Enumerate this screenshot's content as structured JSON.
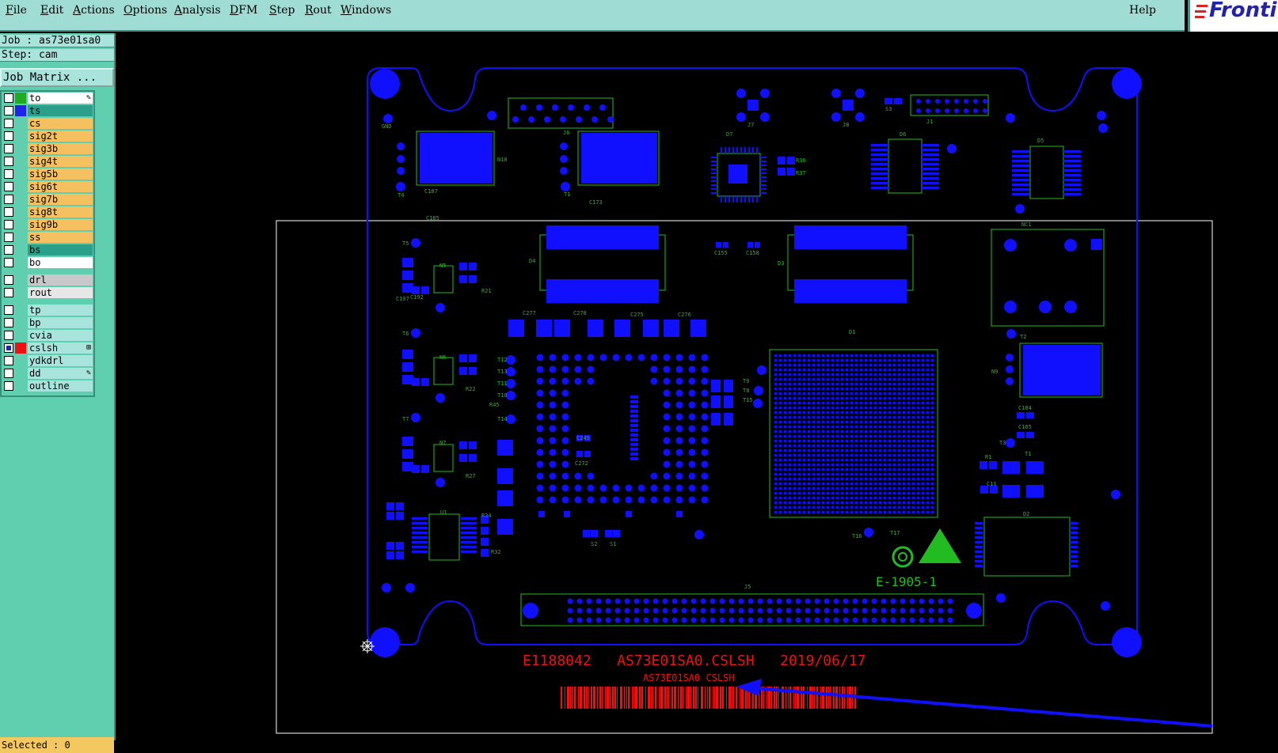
{
  "menu": [
    {
      "label": "File",
      "underline": "F",
      "rest": "ile"
    },
    {
      "label": "Edit",
      "underline": "E",
      "rest": "dit"
    },
    {
      "label": "Actions",
      "underline": "A",
      "rest": "ctions"
    },
    {
      "label": "Options",
      "underline": "O",
      "rest": "ptions"
    },
    {
      "label": "Analysis",
      "underline": "A",
      "rest": "nalysis"
    },
    {
      "label": "DFM",
      "underline": "D",
      "rest": "FM"
    },
    {
      "label": "Step",
      "underline": "S",
      "rest": "tep"
    },
    {
      "label": "Rout",
      "underline": "R",
      "rest": "out"
    },
    {
      "label": "Windows",
      "underline": "W",
      "rest": "indows"
    }
  ],
  "help": "Help",
  "logo": "Fronti",
  "job": "Job : as73e01sa0",
  "step": "Step: cam",
  "job_matrix": "Job Matrix ...",
  "status": "Selected : 0",
  "layers": [
    {
      "name": "to",
      "swatch": "#22aa22",
      "bg": "#ffffff",
      "mark": "✎",
      "checked": false
    },
    {
      "name": "ts",
      "swatch": "#2222ee",
      "bg": "#2aa08a",
      "mark": "",
      "checked": false
    },
    {
      "name": "cs",
      "swatch": "",
      "bg": "#f4c060",
      "mark": "",
      "checked": false
    },
    {
      "name": "sig2t",
      "swatch": "",
      "bg": "#f4c060",
      "mark": "",
      "checked": false
    },
    {
      "name": "sig3b",
      "swatch": "",
      "bg": "#f4c060",
      "mark": "",
      "checked": false
    },
    {
      "name": "sig4t",
      "swatch": "",
      "bg": "#f4c060",
      "mark": "",
      "checked": false
    },
    {
      "name": "sig5b",
      "swatch": "",
      "bg": "#f4c060",
      "mark": "",
      "checked": false
    },
    {
      "name": "sig6t",
      "swatch": "",
      "bg": "#f4c060",
      "mark": "",
      "checked": false
    },
    {
      "name": "sig7b",
      "swatch": "",
      "bg": "#f4c060",
      "mark": "",
      "checked": false
    },
    {
      "name": "sig8t",
      "swatch": "",
      "bg": "#f4c060",
      "mark": "",
      "checked": false
    },
    {
      "name": "sig9b",
      "swatch": "",
      "bg": "#f4c060",
      "mark": "",
      "checked": false
    },
    {
      "name": "ss",
      "swatch": "",
      "bg": "#f4c060",
      "mark": "",
      "checked": false
    },
    {
      "name": "bs",
      "swatch": "",
      "bg": "#2aa08a",
      "mark": "",
      "checked": false
    },
    {
      "name": "bo",
      "swatch": "",
      "bg": "#ffffff",
      "mark": "",
      "checked": false
    },
    {
      "sep": true
    },
    {
      "name": "drl",
      "swatch": "",
      "bg": "#c8c8c8",
      "mark": "",
      "checked": false
    },
    {
      "name": "rout",
      "swatch": "",
      "bg": "#e6e6e6",
      "mark": "",
      "checked": false
    },
    {
      "sep": true
    },
    {
      "name": "tp",
      "swatch": "",
      "bg": "#a8e4dc",
      "mark": "",
      "checked": false
    },
    {
      "name": "bp",
      "swatch": "",
      "bg": "#a8e4dc",
      "mark": "",
      "checked": false
    },
    {
      "name": "cvia",
      "swatch": "",
      "bg": "#a8e4dc",
      "mark": "",
      "checked": false
    },
    {
      "name": "cslsh",
      "swatch": "#ee1111",
      "bg": "#a8e4dc",
      "mark": "⊞",
      "checked": true
    },
    {
      "name": "ydkdrl",
      "swatch": "",
      "bg": "#a8e4dc",
      "mark": "",
      "checked": false
    },
    {
      "name": "dd",
      "swatch": "",
      "bg": "#a8e4dc",
      "mark": "✎",
      "checked": false
    },
    {
      "name": "outline",
      "swatch": "",
      "bg": "#a8e4dc",
      "mark": "",
      "checked": false
    }
  ],
  "board": {
    "marking_line": "E1188042   AS73E01SA0.CSLSH   2019/06/17",
    "marking_small": "AS73E01SA0 CSLSH",
    "date_code": "E-1905-1",
    "colors": {
      "copper": "#1010ff",
      "silk": "#22bb22",
      "marking": "#ee1111",
      "profile": "#ffffff",
      "bg": "#000000"
    },
    "labels": [
      {
        "t": "GND",
        "k": "g1"
      },
      {
        "t": "T4",
        "k": "t4"
      },
      {
        "t": "N10",
        "k": "n10"
      },
      {
        "t": "C187",
        "k": "c187"
      },
      {
        "t": "J6",
        "k": "j6"
      },
      {
        "t": "T1",
        "k": "t1"
      },
      {
        "t": "C173",
        "k": "c173"
      },
      {
        "t": "D7",
        "k": "d7"
      },
      {
        "t": "R36",
        "k": "r36"
      },
      {
        "t": "R37",
        "k": "r37"
      },
      {
        "t": "J7",
        "k": "j7"
      },
      {
        "t": "J8",
        "k": "j8"
      },
      {
        "t": "J1",
        "k": "j1"
      },
      {
        "t": "S3",
        "k": "s3"
      },
      {
        "t": "D6",
        "k": "d6"
      },
      {
        "t": "D5",
        "k": "d5"
      },
      {
        "t": "NC1",
        "k": "nc1"
      },
      {
        "t": "C185",
        "k": "c185"
      },
      {
        "t": "T5",
        "k": "t5"
      },
      {
        "t": "N5",
        "k": "n5"
      },
      {
        "t": "R21",
        "k": "r21"
      },
      {
        "t": "C197",
        "k": "c197"
      },
      {
        "t": "C192",
        "k": "c192"
      },
      {
        "t": "D4",
        "k": "d4"
      },
      {
        "t": "D3",
        "k": "d3"
      },
      {
        "t": "C155",
        "k": "c155"
      },
      {
        "t": "C158",
        "k": "c158"
      },
      {
        "t": "T6",
        "k": "t6"
      },
      {
        "t": "N6",
        "k": "n6"
      },
      {
        "t": "R22",
        "k": "r22"
      },
      {
        "t": "T7",
        "k": "t7"
      },
      {
        "t": "N7",
        "k": "n7"
      },
      {
        "t": "R27",
        "k": "r27"
      },
      {
        "t": "U1",
        "k": "u1"
      },
      {
        "t": "R34",
        "k": "r34"
      },
      {
        "t": "R32",
        "k": "r32"
      },
      {
        "t": "D1",
        "k": "d1"
      },
      {
        "t": "T2",
        "k": "t2"
      },
      {
        "t": "N9",
        "k": "n9"
      },
      {
        "t": "C184",
        "k": "c184"
      },
      {
        "t": "C185",
        "k": "c185b"
      },
      {
        "t": "T3",
        "k": "t3"
      },
      {
        "t": "T1",
        "k": "t1b"
      },
      {
        "t": "R1",
        "k": "r1"
      },
      {
        "t": "C11",
        "k": "c11"
      },
      {
        "t": "D2",
        "k": "d2"
      },
      {
        "t": "T16",
        "k": "t16"
      },
      {
        "t": "T17",
        "k": "t17"
      },
      {
        "t": "J5",
        "k": "j5"
      },
      {
        "t": "S2",
        "k": "s2"
      },
      {
        "t": "S1",
        "k": "s1"
      },
      {
        "t": "C245",
        "k": "c245"
      },
      {
        "t": "C272",
        "k": "c272"
      },
      {
        "t": "C277",
        "k": "c277"
      },
      {
        "t": "C278",
        "k": "c278"
      },
      {
        "t": "C275",
        "k": "c275"
      },
      {
        "t": "C276",
        "k": "c276"
      },
      {
        "t": "T12",
        "k": "t12"
      },
      {
        "t": "T13",
        "k": "t13"
      },
      {
        "t": "T11",
        "k": "t11"
      },
      {
        "t": "T10",
        "k": "t10"
      },
      {
        "t": "T14",
        "k": "t14"
      },
      {
        "t": "R45",
        "k": "r45"
      },
      {
        "t": "T9",
        "k": "t9"
      },
      {
        "t": "T8",
        "k": "t8"
      },
      {
        "t": "T15",
        "k": "t15"
      }
    ]
  }
}
